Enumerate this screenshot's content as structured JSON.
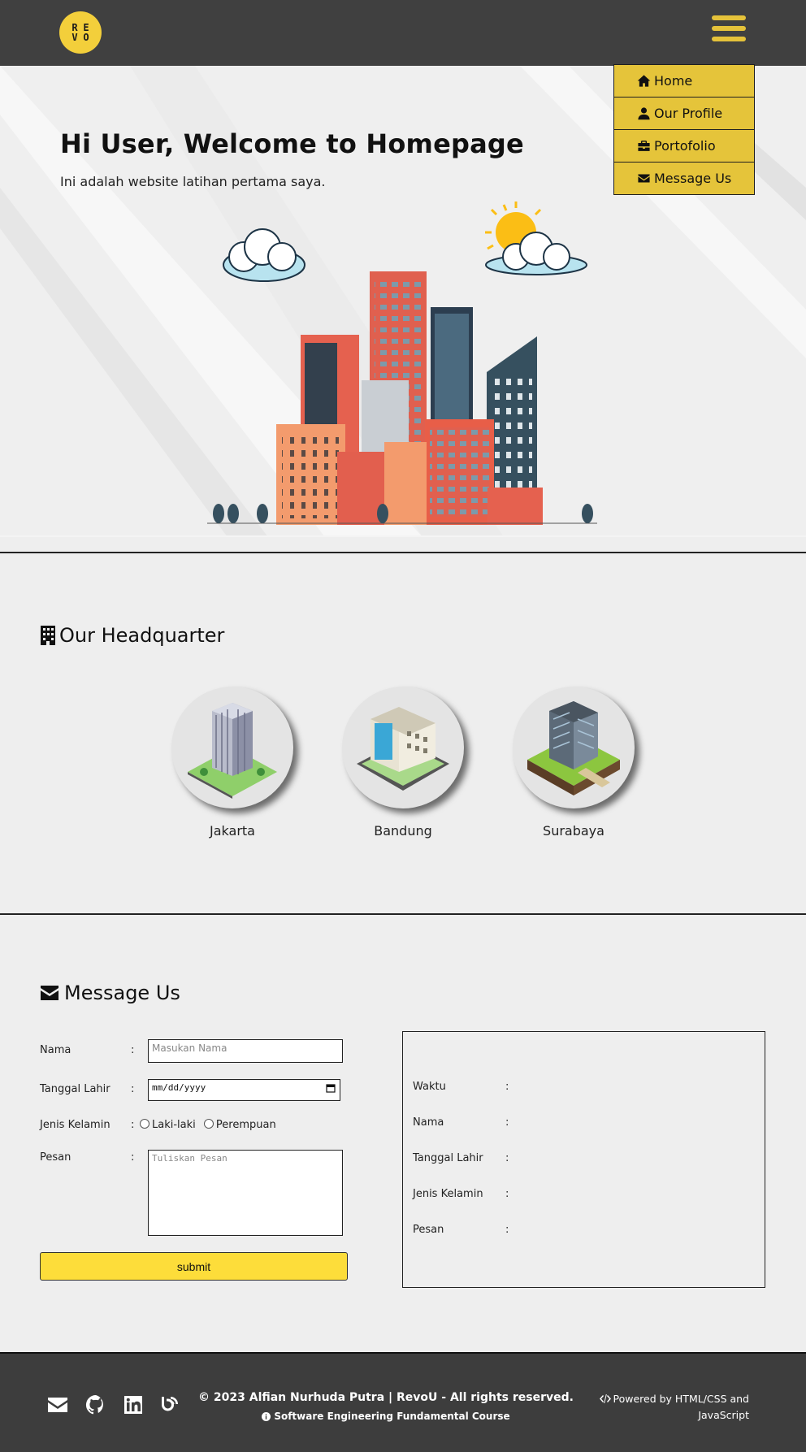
{
  "header": {
    "logo_letters": [
      "R",
      "E",
      "V",
      "O"
    ],
    "menu_icon": "hamburger-menu-icon"
  },
  "nav": {
    "items": [
      {
        "label": "Home",
        "icon": "home-icon"
      },
      {
        "label": "Our Profile",
        "icon": "user-icon"
      },
      {
        "label": "Portofolio",
        "icon": "briefcase-icon"
      },
      {
        "label": "Message Us",
        "icon": "envelope-icon"
      }
    ]
  },
  "hero": {
    "title": "Hi User, Welcome to Homepage",
    "subtitle": "Ini adalah website latihan pertama saya."
  },
  "headquarter": {
    "title": "Our Headquarter",
    "icon": "building-icon",
    "cities": [
      {
        "label": "Jakarta"
      },
      {
        "label": "Bandung"
      },
      {
        "label": "Surabaya"
      }
    ]
  },
  "message": {
    "title": "Message Us",
    "icon": "envelope-icon",
    "form": {
      "nama_label": "Nama",
      "nama_placeholder": "Masukan Nama",
      "tanggal_label": "Tanggal Lahir",
      "tanggal_placeholder": "mm/dd/yyyy",
      "gender_label": "Jenis Kelamin",
      "gender_options": [
        "Laki-laki",
        "Perempuan"
      ],
      "pesan_label": "Pesan",
      "pesan_placeholder": "Tuliskan Pesan",
      "colon": ":",
      "submit_label": "submit"
    },
    "result": {
      "rows": [
        {
          "label": "Waktu",
          "value": ""
        },
        {
          "label": "Nama",
          "value": ""
        },
        {
          "label": "Tanggal Lahir",
          "value": ""
        },
        {
          "label": "Jenis Kelamin",
          "value": ""
        },
        {
          "label": "Pesan",
          "value": ""
        }
      ]
    }
  },
  "footer": {
    "social_icons": [
      "mail-icon",
      "github-icon",
      "linkedin-icon",
      "blog-icon"
    ],
    "copyright": "© 2023 Alfian Nurhuda Putra | RevoU - All rights reserved.",
    "course": "Software Engineering Fundamental Course",
    "powered": "Powered by HTML/CSS and JavaScript"
  },
  "colors": {
    "header_bg": "#404040",
    "accent_yellow": "#e5c43a",
    "submit_yellow": "#fddd3a",
    "footer_bg": "#3d3d3d"
  }
}
